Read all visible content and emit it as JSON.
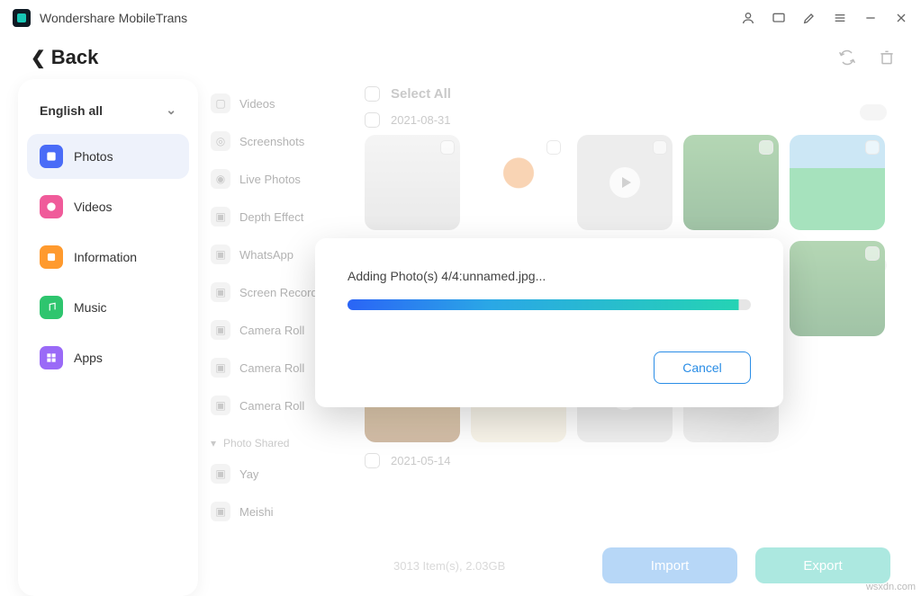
{
  "app": {
    "title": "Wondershare MobileTrans"
  },
  "back": {
    "label": "Back"
  },
  "sidebar": {
    "header": "English all",
    "items": [
      {
        "label": "Photos"
      },
      {
        "label": "Videos"
      },
      {
        "label": "Information"
      },
      {
        "label": "Music"
      },
      {
        "label": "Apps"
      }
    ]
  },
  "sublist": {
    "items": [
      {
        "label": "Videos"
      },
      {
        "label": "Screenshots"
      },
      {
        "label": "Live Photos"
      },
      {
        "label": "Depth Effect"
      },
      {
        "label": "WhatsApp"
      },
      {
        "label": "Screen Recorder"
      },
      {
        "label": "Camera Roll"
      },
      {
        "label": "Camera Roll"
      },
      {
        "label": "Camera Roll"
      }
    ],
    "shared_label": "Photo Shared",
    "extra": [
      {
        "label": "Yay"
      },
      {
        "label": "Meishi"
      }
    ]
  },
  "content": {
    "select_all": "Select All",
    "group1": "2021-08-31",
    "group2": "2021-05-14",
    "footer_info": "3013 Item(s), 2.03GB",
    "import": "Import",
    "export": "Export"
  },
  "modal": {
    "message": "Adding Photo(s) 4/4:unnamed.jpg...",
    "cancel": "Cancel"
  },
  "watermark": "wsxdn.com"
}
